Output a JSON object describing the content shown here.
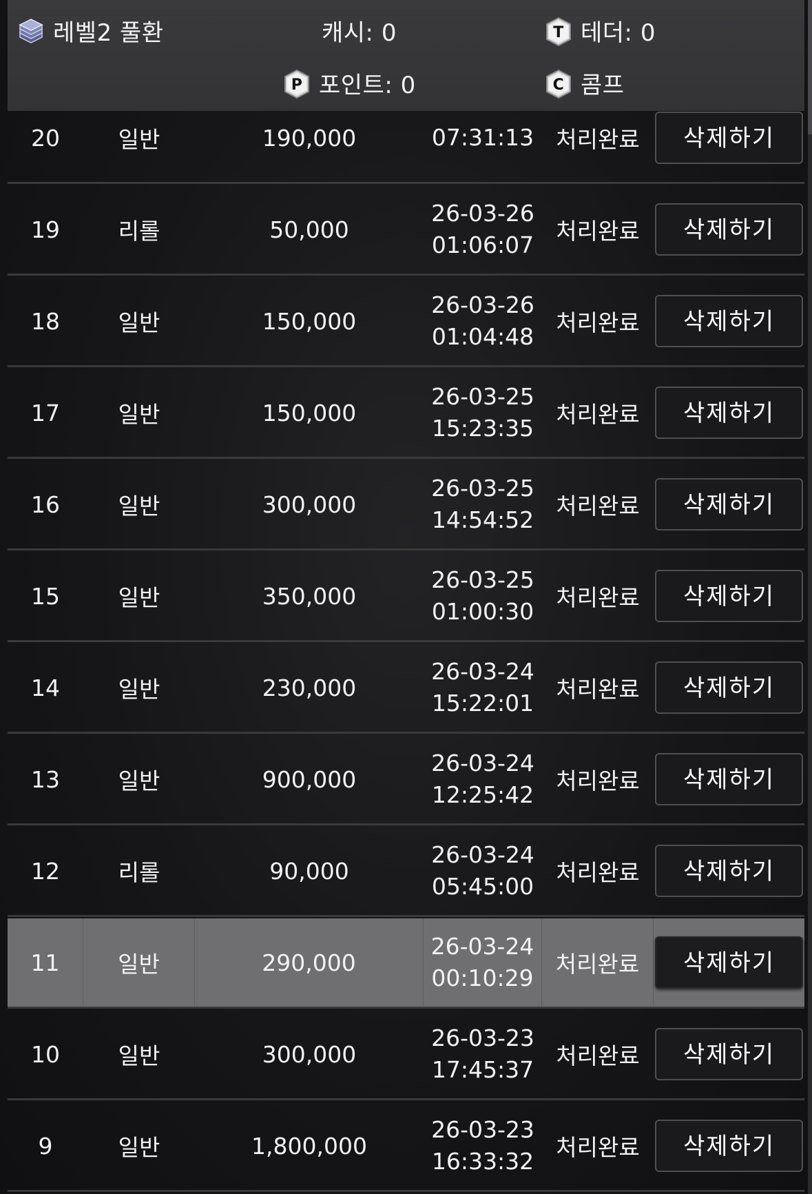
{
  "header": {
    "level": "레벨2 풀환",
    "cash": "캐시: 0",
    "tether": "테더: 0",
    "point": "포인트: 0",
    "comp": "콤프",
    "icons": {
      "level": "layers-stack-icon",
      "tether": "tether-coin-icon",
      "point": "point-coin-icon",
      "comp": "comp-coin-icon"
    }
  },
  "table": {
    "delete_label": "삭제하기",
    "rows": [
      {
        "no": "20",
        "type": "일반",
        "amount": "190,000",
        "date": "",
        "time": "07:31:13",
        "status": "처리완료"
      },
      {
        "no": "19",
        "type": "리롤",
        "amount": "50,000",
        "date": "26-03-26",
        "time": "01:06:07",
        "status": "처리완료"
      },
      {
        "no": "18",
        "type": "일반",
        "amount": "150,000",
        "date": "26-03-26",
        "time": "01:04:48",
        "status": "처리완료"
      },
      {
        "no": "17",
        "type": "일반",
        "amount": "150,000",
        "date": "26-03-25",
        "time": "15:23:35",
        "status": "처리완료"
      },
      {
        "no": "16",
        "type": "일반",
        "amount": "300,000",
        "date": "26-03-25",
        "time": "14:54:52",
        "status": "처리완료"
      },
      {
        "no": "15",
        "type": "일반",
        "amount": "350,000",
        "date": "26-03-25",
        "time": "01:00:30",
        "status": "처리완료"
      },
      {
        "no": "14",
        "type": "일반",
        "amount": "230,000",
        "date": "26-03-24",
        "time": "15:22:01",
        "status": "처리완료"
      },
      {
        "no": "13",
        "type": "일반",
        "amount": "900,000",
        "date": "26-03-24",
        "time": "12:25:42",
        "status": "처리완료"
      },
      {
        "no": "12",
        "type": "리롤",
        "amount": "90,000",
        "date": "26-03-24",
        "time": "05:45:00",
        "status": "처리완료"
      },
      {
        "no": "11",
        "type": "일반",
        "amount": "290,000",
        "date": "26-03-24",
        "time": "00:10:29",
        "status": "처리완료"
      },
      {
        "no": "10",
        "type": "일반",
        "amount": "300,000",
        "date": "26-03-23",
        "time": "17:45:37",
        "status": "처리완료"
      },
      {
        "no": "9",
        "type": "일반",
        "amount": "1,800,000",
        "date": "26-03-23",
        "time": "16:33:32",
        "status": "처리완료"
      }
    ]
  }
}
